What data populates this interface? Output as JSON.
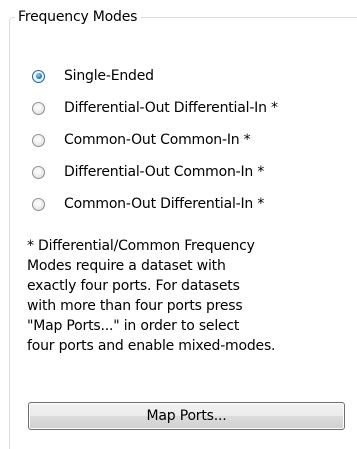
{
  "group": {
    "title": "Frequency Modes"
  },
  "modes": [
    {
      "label": "Single-Ended",
      "checked": true
    },
    {
      "label": "Differential-Out Differential-In *",
      "checked": false
    },
    {
      "label": "Common-Out Common-In *",
      "checked": false
    },
    {
      "label": "Differential-Out Common-In *",
      "checked": false
    },
    {
      "label": "Common-Out Differential-In *",
      "checked": false
    }
  ],
  "note": "* Differential/Common Frequency\nModes require a dataset with\nexactly four ports. For datasets\nwith more than four ports press\n\"Map Ports...\" in order to select\nfour ports and enable mixed-modes.",
  "buttons": {
    "map_ports": "Map Ports..."
  },
  "colors": {
    "groupbox_border": "#d5dfe5",
    "radio_selected": "#2d7fc2"
  }
}
